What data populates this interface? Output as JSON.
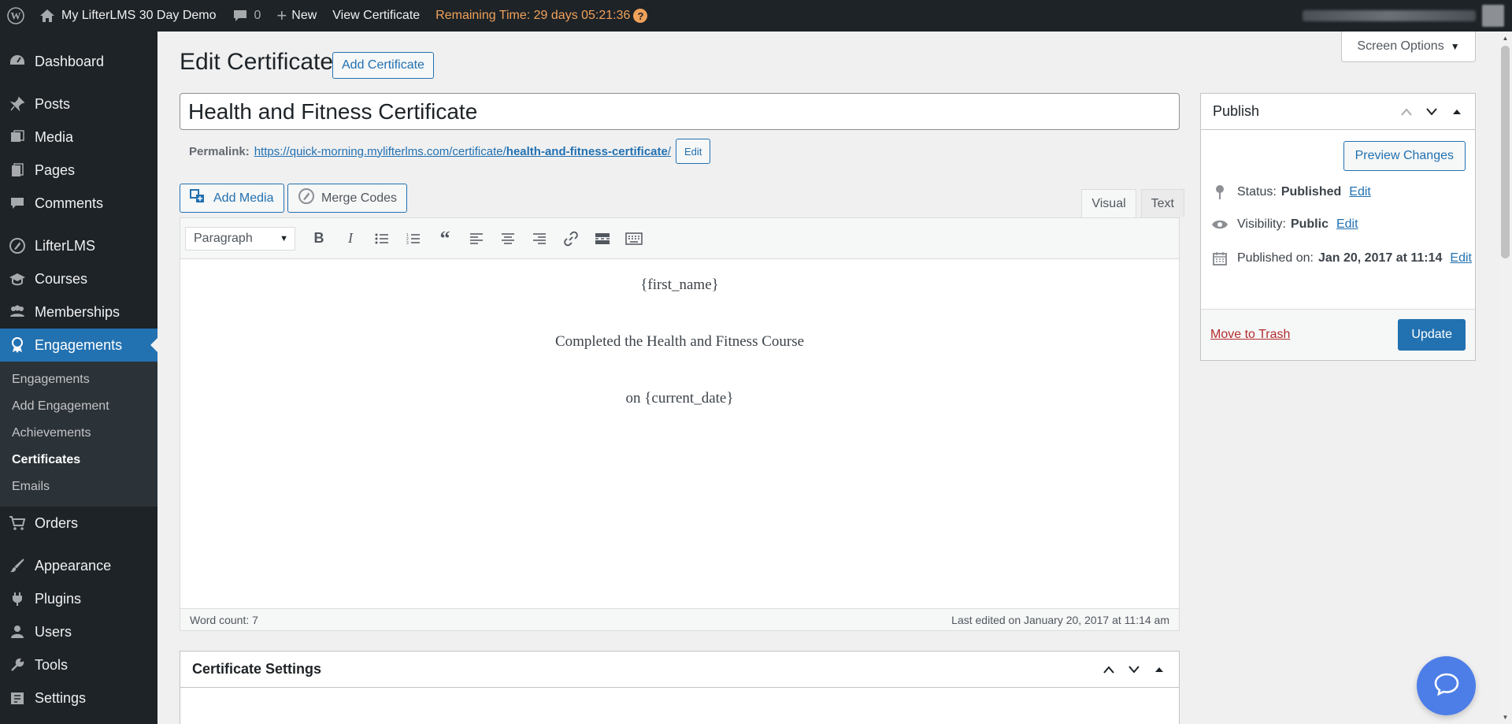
{
  "adminbar": {
    "site_name": "My LifterLMS 30 Day Demo",
    "comments_count": "0",
    "new_label": "New",
    "view_label": "View Certificate",
    "remaining_time": "Remaining Time: 29 days 05:21:36",
    "help_glyph": "?"
  },
  "sidebar": {
    "items": {
      "dashboard": "Dashboard",
      "posts": "Posts",
      "media": "Media",
      "pages": "Pages",
      "comments": "Comments",
      "lifterlms": "LifterLMS",
      "courses": "Courses",
      "memberships": "Memberships",
      "engagements": "Engagements",
      "orders": "Orders",
      "appearance": "Appearance",
      "plugins": "Plugins",
      "users": "Users",
      "tools": "Tools",
      "settings": "Settings"
    },
    "submenu": {
      "engagements": "Engagements",
      "add_engagement": "Add Engagement",
      "achievements": "Achievements",
      "certificates": "Certificates",
      "emails": "Emails"
    }
  },
  "screen_options": "Screen Options",
  "page": {
    "title": "Edit Certificate",
    "add_button": "Add Certificate"
  },
  "post": {
    "title": "Health and Fitness Certificate",
    "permalink_label": "Permalink:",
    "permalink_base": "https://quick-morning.mylifterlms.com/certificate/",
    "permalink_slug": "health-and-fitness-certificate",
    "permalink_trailing": "/",
    "permalink_edit": "Edit"
  },
  "editor": {
    "add_media": "Add Media",
    "merge_codes": "Merge Codes",
    "tab_visual": "Visual",
    "tab_text": "Text",
    "format": "Paragraph",
    "content": {
      "line1": "{first_name}",
      "line2": "Completed the Health and Fitness Course",
      "line3": "on {current_date}"
    },
    "word_count": "Word count: 7",
    "last_edited": "Last edited on January 20, 2017 at 11:14 am"
  },
  "settings_box": {
    "title": "Certificate Settings"
  },
  "publish": {
    "title": "Publish",
    "preview": "Preview Changes",
    "status_label": "Status:",
    "status_value": "Published",
    "visibility_label": "Visibility:",
    "visibility_value": "Public",
    "published_label": "Published on:",
    "published_value": "Jan 20, 2017 at 11:14",
    "edit": "Edit",
    "trash": "Move to Trash",
    "update": "Update"
  },
  "colors": {
    "adminbar_bg": "#1d2327",
    "accent": "#2271b1",
    "remaining_time": "#f0a15a",
    "help_bubble": "#4d7ee8"
  },
  "icons": {
    "wordpress": "wordpress-logo-icon",
    "home": "home-icon",
    "comment": "comment-bubble-icon",
    "plus": "plus-icon",
    "dashboard": "dashboard-gauge-icon",
    "posts": "pushpin-icon",
    "media": "media-icon",
    "pages": "pages-icon",
    "comments": "comments-icon",
    "lifterlms": "lifterlms-icon",
    "courses": "courses-icon",
    "memberships": "memberships-icon",
    "engagements": "award-icon",
    "orders": "cart-icon",
    "appearance": "brush-icon",
    "plugins": "plug-icon",
    "users": "user-icon",
    "tools": "wrench-icon",
    "settings": "settings-icon",
    "help_chat": "chat-bubble-icon"
  }
}
